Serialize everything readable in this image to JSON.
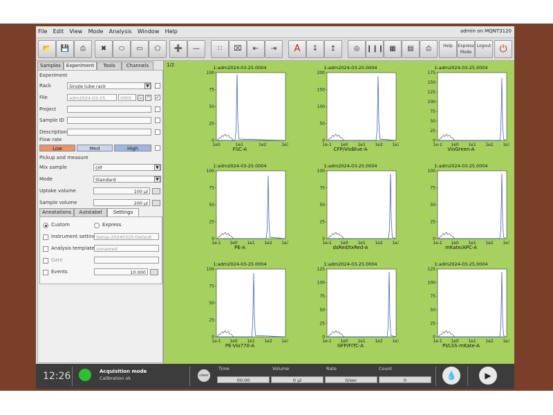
{
  "menubar": {
    "items": [
      "File",
      "Edit",
      "View",
      "Mode",
      "Analysis",
      "Window",
      "Help"
    ],
    "user": "admin on MQNT3120"
  },
  "toolbar": {
    "help_label": "Help",
    "express_label": "Express Mode",
    "logout_label": "Logout"
  },
  "left_tabs": [
    "Samples",
    "Experiment",
    "Tools",
    "Channels"
  ],
  "experiment": {
    "section_experiment": "Experiment",
    "rack_label": "Rack",
    "rack_value": "Single tube rack",
    "file_label": "File",
    "file_value": "adm2024-03-25",
    "file_number": "0005",
    "project_label": "Project",
    "sample_id_label": "Sample ID",
    "description_label": "Description",
    "flow_rate_label": "Flow rate",
    "flow_low": "Low",
    "flow_med": "Med",
    "flow_high": "High",
    "pickup_label": "Pickup and measure",
    "mix_label": "Mix sample",
    "mix_value": "Off",
    "mode_label": "Mode",
    "mode_value": "Standard",
    "uptake_label": "Uptake volume",
    "uptake_value": "100 µl",
    "sample_vol_label": "Sample volume",
    "sample_vol_value": "200 µl"
  },
  "sub_tabs": [
    "Annotations",
    "Autolabel",
    "Settings"
  ],
  "settings": {
    "custom_label": "Custom",
    "express_label": "Express",
    "instrument_label": "Instrument setting",
    "instrument_value": "Setup-20240325-Default",
    "analysis_label": "Analysis template",
    "analysis_value": "unnamed",
    "gate_label": "Gate",
    "events_label": "Events",
    "events_value": "10.000"
  },
  "page_indicator": "1/2",
  "plots": [
    {
      "title": "1:adm2024-03-25.0004",
      "xlabel": "FSC-A",
      "yticks": [
        "100",
        "75",
        "50",
        "25",
        "0"
      ],
      "xticks": [
        "1e0",
        "1e1",
        "1e2",
        "1e3"
      ]
    },
    {
      "title": "1:adm2024-03-25.0004",
      "xlabel": "CFP/VioBlue-A",
      "yticks": [
        "200",
        "150",
        "100",
        "50",
        "0"
      ],
      "xticks": [
        "1e-1",
        "1e0",
        "1e1",
        "1e2",
        "1e3"
      ]
    },
    {
      "title": "1:adm2024-03-25.0004",
      "xlabel": "VioGreen-A",
      "yticks": [
        "175",
        "150",
        "125",
        "100",
        "75",
        "50",
        "25",
        "0"
      ],
      "xticks": [
        "1e-1",
        "1e0",
        "1e1",
        "1e2",
        "1e3"
      ]
    },
    {
      "title": "1:adm2024-03-25.0004",
      "xlabel": "PE-A",
      "yticks": [
        "100",
        "75",
        "50",
        "25",
        "0"
      ],
      "xticks": [
        "1e-1",
        "1e0",
        "1e1",
        "1e2",
        "1e3"
      ]
    },
    {
      "title": "1:adm2024-03-25.0004",
      "xlabel": "dsRed/txRed-A",
      "yticks": [
        "100",
        "75",
        "50",
        "25",
        "0"
      ],
      "xticks": [
        "1e-1",
        "1e0",
        "1e1",
        "1e2",
        "1e3"
      ]
    },
    {
      "title": "1:adm2024-03-25.0004",
      "xlabel": "mKate/APC-A",
      "yticks": [
        "100",
        "75",
        "50",
        "25",
        "0"
      ],
      "xticks": [
        "1e-1",
        "1e0",
        "1e1",
        "1e2",
        "1e3"
      ]
    },
    {
      "title": "1:adm2024-03-25.0004",
      "xlabel": "PE-Vio770-A",
      "yticks": [
        "100",
        "75",
        "50",
        "25",
        "0"
      ],
      "xticks": [
        "1e-1",
        "1e0",
        "1e1",
        "1e2",
        "1e3"
      ]
    },
    {
      "title": "1:adm2024-03-25.0004",
      "xlabel": "GFP/FITC-A",
      "yticks": [
        "125",
        "100",
        "75",
        "50",
        "25",
        "0"
      ],
      "xticks": [
        "1e-1",
        "1e0",
        "1e1",
        "1e2",
        "1e3"
      ]
    },
    {
      "title": "1:adm2024-03-25.0004",
      "xlabel": "PI/LSS-mKate-A",
      "yticks": [
        "125",
        "100",
        "75",
        "50",
        "25",
        "0"
      ],
      "xticks": [
        "1e-1",
        "1e0",
        "1e1",
        "1e2",
        "1e3"
      ]
    }
  ],
  "status": {
    "time": "12:26",
    "acq_mode": "Acquisition mode",
    "calibration": "Calibration ok",
    "clear_label": "clear",
    "time_label": "Time",
    "time_value": "00:00",
    "volume_label": "Volume",
    "volume_value": "0 µl",
    "rate_label": "Rate",
    "rate_value": "0/sec",
    "count_label": "Count",
    "count_value": "0"
  },
  "colors": {
    "plot_area": "#a6d15e",
    "status_led": "#2fc02f",
    "histogram_blue": "#2a4fbf",
    "flow_low": "#e8956a",
    "flow_selected": "#9fb6e0"
  }
}
